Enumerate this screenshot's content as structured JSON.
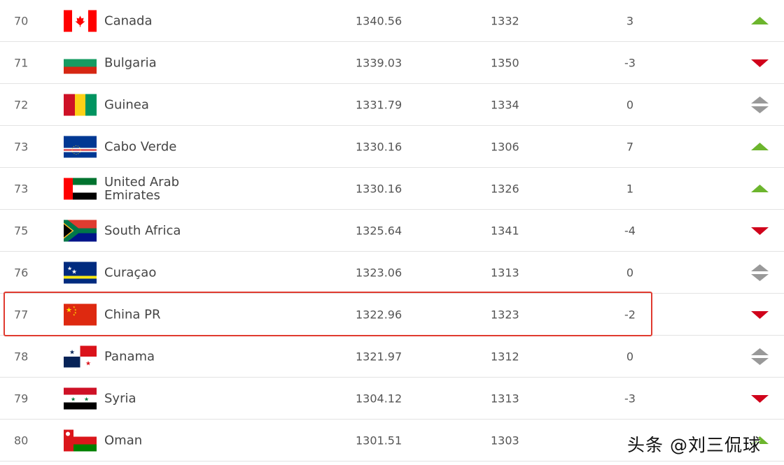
{
  "colors": {
    "up": "#6cb52d",
    "down": "#d0021b",
    "same": "#999999",
    "highlight": "#e03a2f"
  },
  "rows": [
    {
      "rank": "70",
      "country": "Canada",
      "flag": "canada",
      "points": "1340.56",
      "previous_points": "1332",
      "change": "3",
      "trend": "up"
    },
    {
      "rank": "71",
      "country": "Bulgaria",
      "flag": "bulgaria",
      "points": "1339.03",
      "previous_points": "1350",
      "change": "-3",
      "trend": "down"
    },
    {
      "rank": "72",
      "country": "Guinea",
      "flag": "guinea",
      "points": "1331.79",
      "previous_points": "1334",
      "change": "0",
      "trend": "same"
    },
    {
      "rank": "73",
      "country": "Cabo Verde",
      "flag": "cabo-verde",
      "points": "1330.16",
      "previous_points": "1306",
      "change": "7",
      "trend": "up"
    },
    {
      "rank": "73",
      "country": "United Arab Emirates",
      "flag": "uae",
      "points": "1330.16",
      "previous_points": "1326",
      "change": "1",
      "trend": "up"
    },
    {
      "rank": "75",
      "country": "South Africa",
      "flag": "south-africa",
      "points": "1325.64",
      "previous_points": "1341",
      "change": "-4",
      "trend": "down"
    },
    {
      "rank": "76",
      "country": "Curaçao",
      "flag": "curacao",
      "points": "1323.06",
      "previous_points": "1313",
      "change": "0",
      "trend": "same"
    },
    {
      "rank": "77",
      "country": "China PR",
      "flag": "china",
      "points": "1322.96",
      "previous_points": "1323",
      "change": "-2",
      "trend": "down",
      "highlighted": true
    },
    {
      "rank": "78",
      "country": "Panama",
      "flag": "panama",
      "points": "1321.97",
      "previous_points": "1312",
      "change": "0",
      "trend": "same"
    },
    {
      "rank": "79",
      "country": "Syria",
      "flag": "syria",
      "points": "1304.12",
      "previous_points": "1313",
      "change": "-3",
      "trend": "down"
    },
    {
      "rank": "80",
      "country": "Oman",
      "flag": "oman",
      "points": "1301.51",
      "previous_points": "1303",
      "change": "",
      "trend": "up"
    }
  ],
  "watermark": "头条 @刘三侃球"
}
